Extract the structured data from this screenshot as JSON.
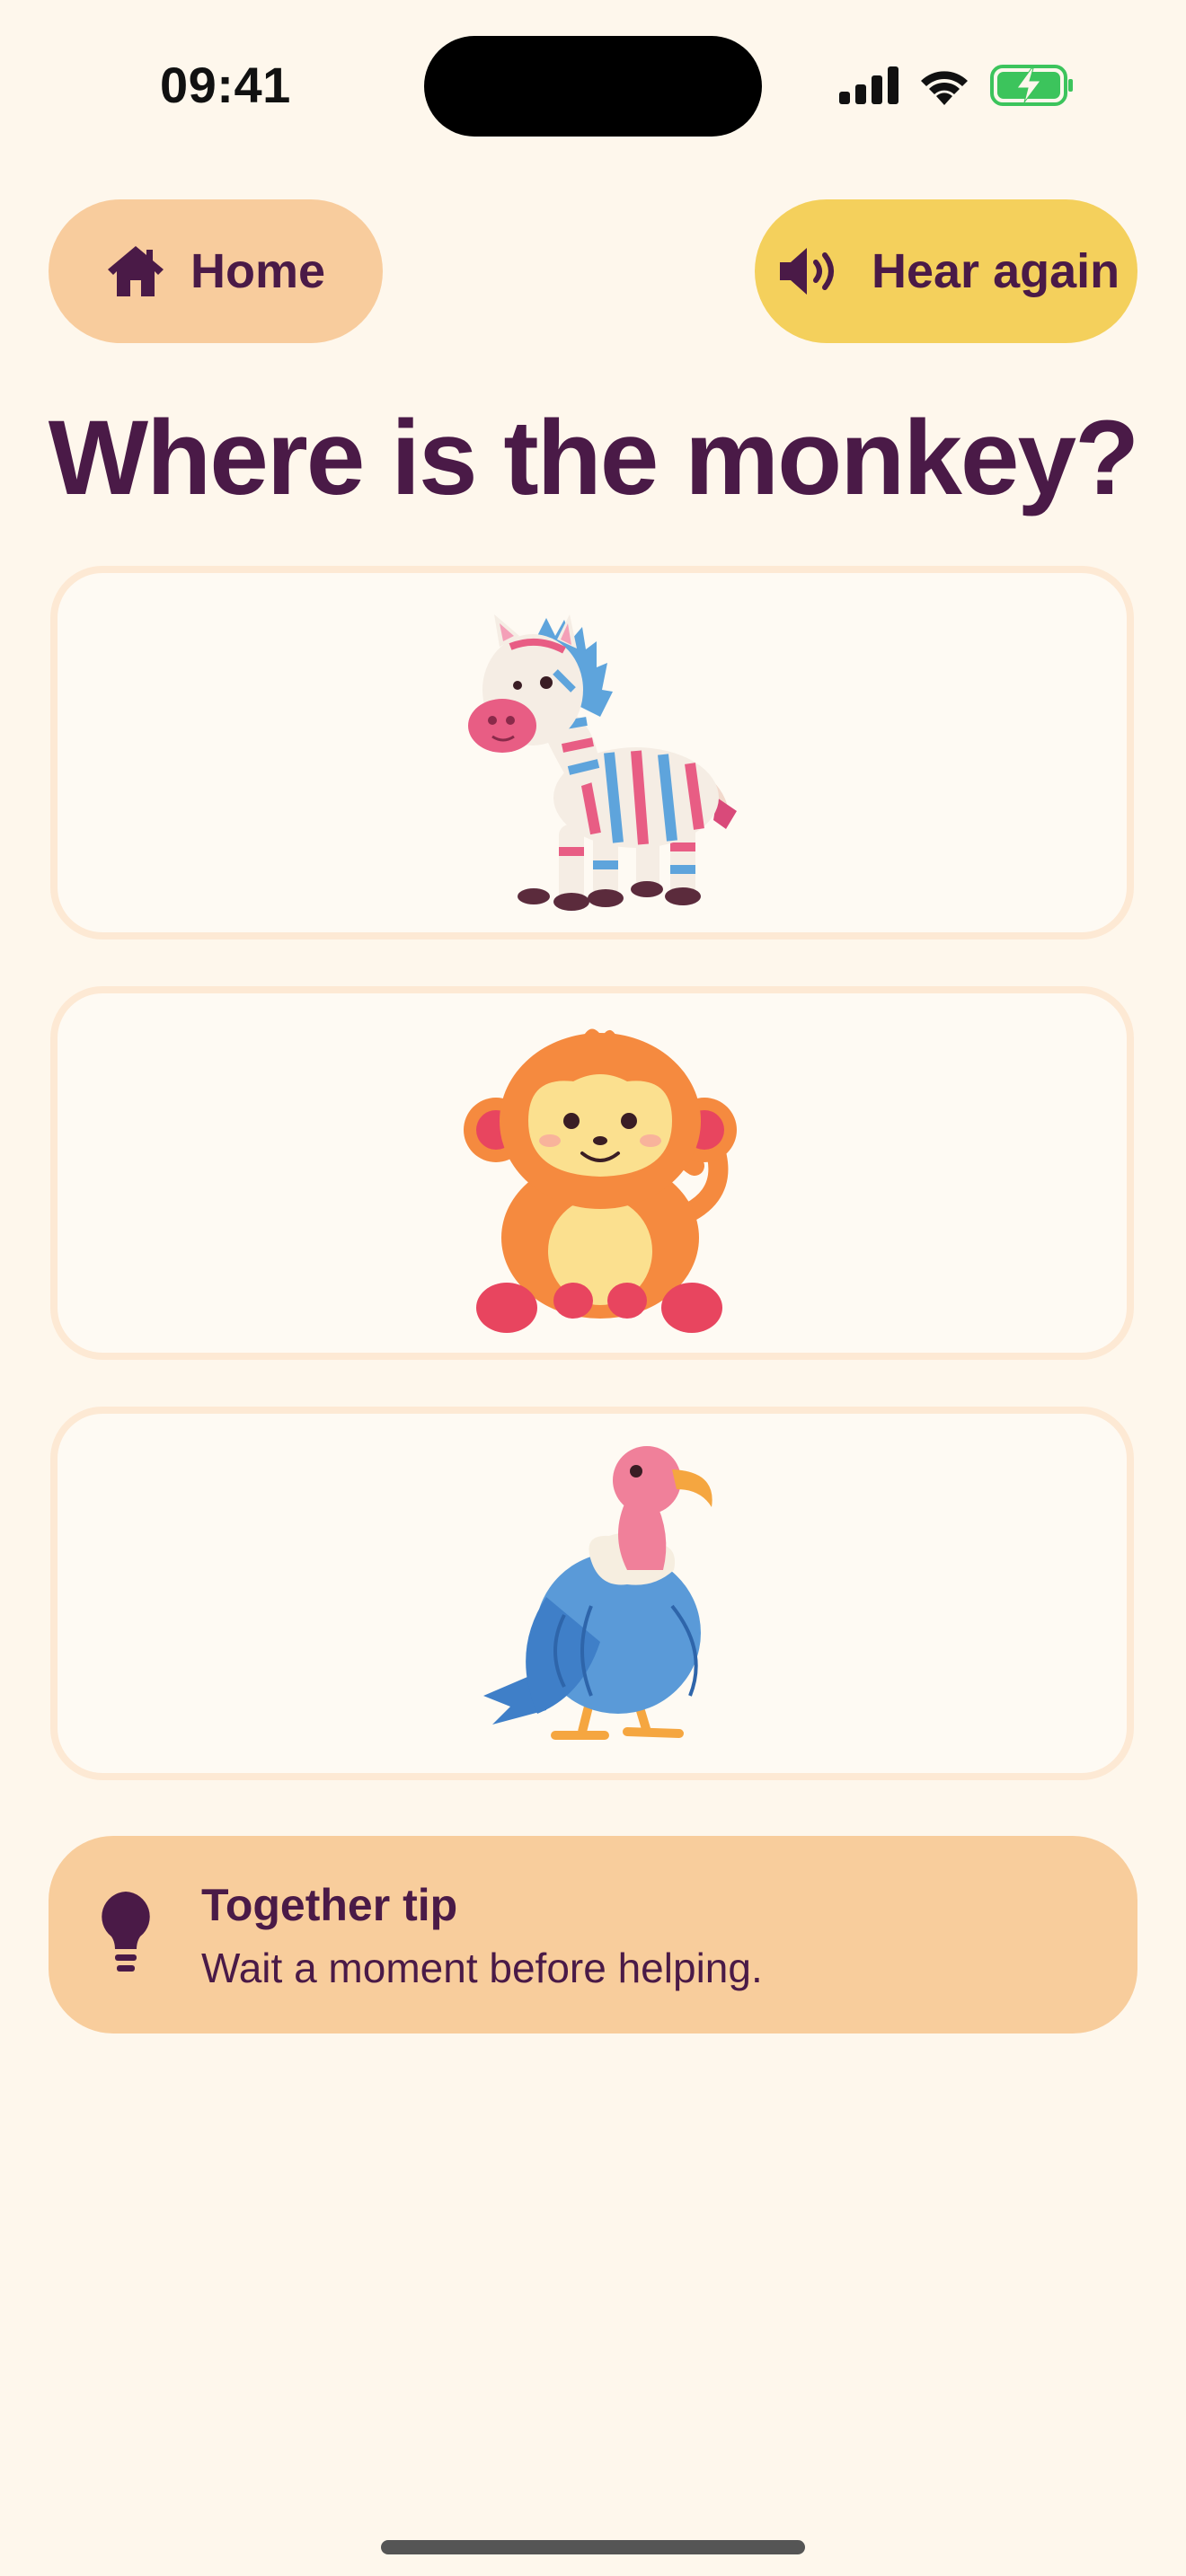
{
  "status_bar": {
    "time": "09:41"
  },
  "nav": {
    "home_label": "Home",
    "home_icon": "home-icon",
    "hear_label": "Hear again",
    "hear_icon": "speaker-icon"
  },
  "question": "Where is the monkey?",
  "choices": [
    {
      "animal": "zebra"
    },
    {
      "animal": "monkey"
    },
    {
      "animal": "vulture"
    }
  ],
  "tip": {
    "title": "Together tip",
    "text": "Wait a moment before helping.",
    "icon": "lightbulb-icon"
  },
  "colors": {
    "background": "#fef7ec",
    "text": "#4a1a47",
    "home_button": "#f8cc9d",
    "hear_button": "#f4d05c",
    "card_border": "#fde9d4",
    "tip_background": "#f8cd9c",
    "battery": "#3cc45c"
  }
}
